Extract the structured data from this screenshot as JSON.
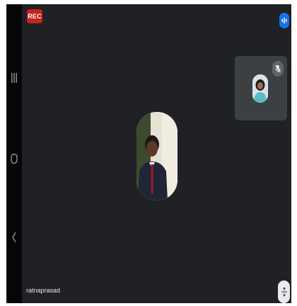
{
  "call": {
    "rec_label": "REC",
    "participant_name": "ratnaprasad",
    "main_avatar_icon": "person-avatar",
    "self_avatar_icon": "person-avatar",
    "self_mic_icon": "mic-off-icon",
    "activity_icon": "activity-bars-icon",
    "layout_icon": "expand-arrows-icon"
  },
  "nav": {
    "recents_icon": "recents-icon",
    "home_icon": "home-icon",
    "back_icon": "back-icon"
  },
  "colors": {
    "stage": "#202124",
    "rec": "#c5221f",
    "accent": "#1a73e8",
    "tile": "#3c4043"
  }
}
